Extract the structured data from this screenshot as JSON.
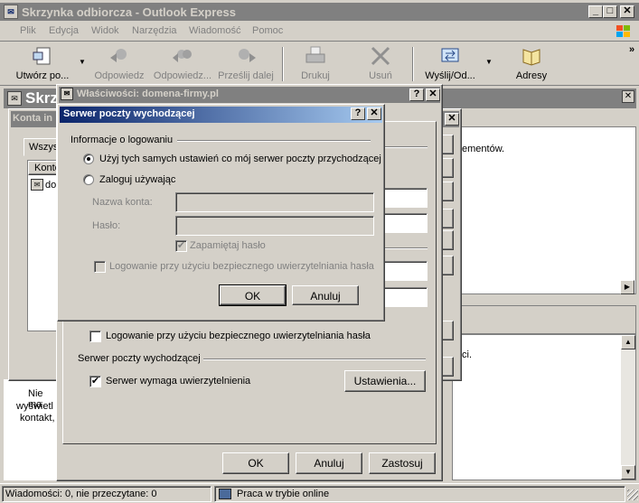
{
  "main_window": {
    "title": "Skrzynka odbiorcza - Outlook Express",
    "menu": [
      "Plik",
      "Edycja",
      "Widok",
      "Narzędzia",
      "Wiadomość",
      "Pomoc"
    ],
    "toolbar": [
      {
        "label": "Utwórz po...",
        "icon": "new-mail-icon"
      },
      {
        "label": "Odpowiedz",
        "icon": "reply-icon"
      },
      {
        "label": "Odpowiedz...",
        "icon": "reply-all-icon"
      },
      {
        "label": "Prześlij dalej",
        "icon": "forward-icon"
      },
      {
        "label": "Drukuj",
        "icon": "print-icon"
      },
      {
        "label": "Usuń",
        "icon": "delete-icon"
      },
      {
        "label": "Wyślij/Od...",
        "icon": "send-receive-icon"
      },
      {
        "label": "Adresy",
        "icon": "address-book-icon"
      }
    ],
    "folder_bar_title": "Skrz",
    "right_text": "ementów.",
    "right_text2": "ci.",
    "left_text_lines": [
      "Nie ma",
      "wyświetl",
      "kontakt,"
    ]
  },
  "status_bar": {
    "messages": "Wiadomości: 0, nie przeczytane: 0",
    "online": "Praca w trybie online"
  },
  "accounts_dialog": {
    "title": "Konta in",
    "tab": "Wszys",
    "column": "Konto",
    "item": "do"
  },
  "properties_dialog": {
    "title": "Właściwości: domena-firmy.pl",
    "login_spa": "Logowanie przy użyciu bezpiecznego uwierzytelniania hasła",
    "outgoing_group": "Serwer poczty wychodzącej",
    "requires_auth": "Serwer wymaga uwierzytelnienia",
    "settings_button": "Ustawienia...",
    "ok": "OK",
    "cancel": "Anuluj",
    "apply": "Zastosuj"
  },
  "outgoing_dialog": {
    "title": "Serwer poczty wychodzącej",
    "group": "Informacje o logowaniu",
    "radio_same": "Użyj tych samych ustawień co mój serwer poczty przychodzącej",
    "radio_login": "Zaloguj używając",
    "account_label": "Nazwa konta:",
    "account_value": "",
    "password_label": "Hasło:",
    "password_value": "",
    "remember": "Zapamiętaj hasło",
    "spa": "Logowanie przy użyciu bezpiecznego uwierzytelniania hasła",
    "ok": "OK",
    "cancel": "Anuluj"
  }
}
